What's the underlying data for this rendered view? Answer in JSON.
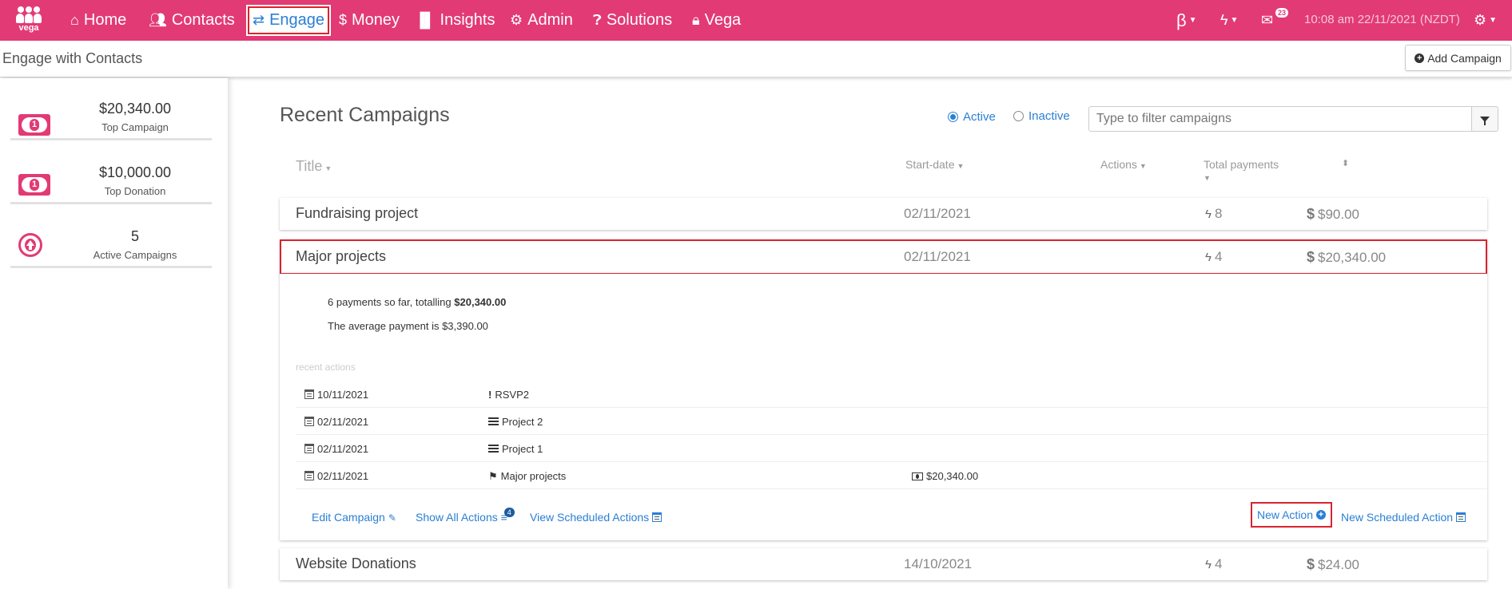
{
  "brand": {
    "logo_text": "vega"
  },
  "nav": {
    "items": [
      {
        "label": "Home",
        "icon": "home-icon"
      },
      {
        "label": "Contacts",
        "icon": "users-icon"
      },
      {
        "label": "Engage",
        "icon": "exchange-icon"
      },
      {
        "label": "Money",
        "icon": "dollar-icon"
      },
      {
        "label": "Insights",
        "icon": "bar-chart-icon"
      },
      {
        "label": "Admin",
        "icon": "cogs-icon"
      },
      {
        "label": "Solutions",
        "icon": "question-icon"
      },
      {
        "label": "Vega",
        "icon": "lock-icon"
      }
    ],
    "beta": "β",
    "mail_count": "23",
    "datetime": "10:08 am 22/11/2021 (NZDT)"
  },
  "subheader": {
    "title": "Engage with Contacts",
    "add_campaign": "Add Campaign"
  },
  "sidebar": {
    "stats": [
      {
        "amount": "$20,340.00",
        "label": "Top Campaign",
        "icon": "money-icon"
      },
      {
        "amount": "$10,000.00",
        "label": "Top Donation",
        "icon": "money-icon"
      },
      {
        "amount": "5",
        "label": "Active Campaigns",
        "icon": "arrow-up-circle-icon"
      }
    ]
  },
  "main": {
    "title": "Recent Campaigns",
    "filter": {
      "active": "Active",
      "inactive": "Inactive",
      "placeholder": "Type to filter campaigns",
      "selected": "Active"
    },
    "columns": {
      "title": "Title",
      "start_date": "Start-date",
      "actions": "Actions",
      "total_payments": "Total payments"
    },
    "campaigns": [
      {
        "title": "Fundraising project",
        "start": "02/11/2021",
        "actions": "8",
        "total": "$90.00"
      },
      {
        "title": "Major projects",
        "start": "02/11/2021",
        "actions": "4",
        "total": "$20,340.00"
      },
      {
        "title": "Website Donations",
        "start": "14/10/2021",
        "actions": "4",
        "total": "$24.00"
      }
    ],
    "detail": {
      "payments_prefix": "6 payments so far, totalling ",
      "payments_total": "$20,340.00",
      "average": "The average payment is $3,390.00",
      "recent_label": "recent actions",
      "actions": [
        {
          "date": "10/11/2021",
          "name": "RSVP2",
          "type": "exclamation-icon",
          "amount": ""
        },
        {
          "date": "02/11/2021",
          "name": "Project 2",
          "type": "list-icon",
          "amount": ""
        },
        {
          "date": "02/11/2021",
          "name": "Project 1",
          "type": "list-icon",
          "amount": ""
        },
        {
          "date": "02/11/2021",
          "name": "Major projects",
          "type": "flag-icon",
          "amount": "$20,340.00"
        }
      ],
      "links": {
        "edit": "Edit Campaign",
        "show_all": "Show All Actions",
        "show_all_count": "4",
        "view_scheduled": "View Scheduled Actions",
        "new_action": "New Action",
        "new_scheduled": "New Scheduled Action"
      }
    }
  },
  "colors": {
    "brand": "#e23a74",
    "link": "#2a7fd4",
    "highlight": "#d9232f"
  }
}
